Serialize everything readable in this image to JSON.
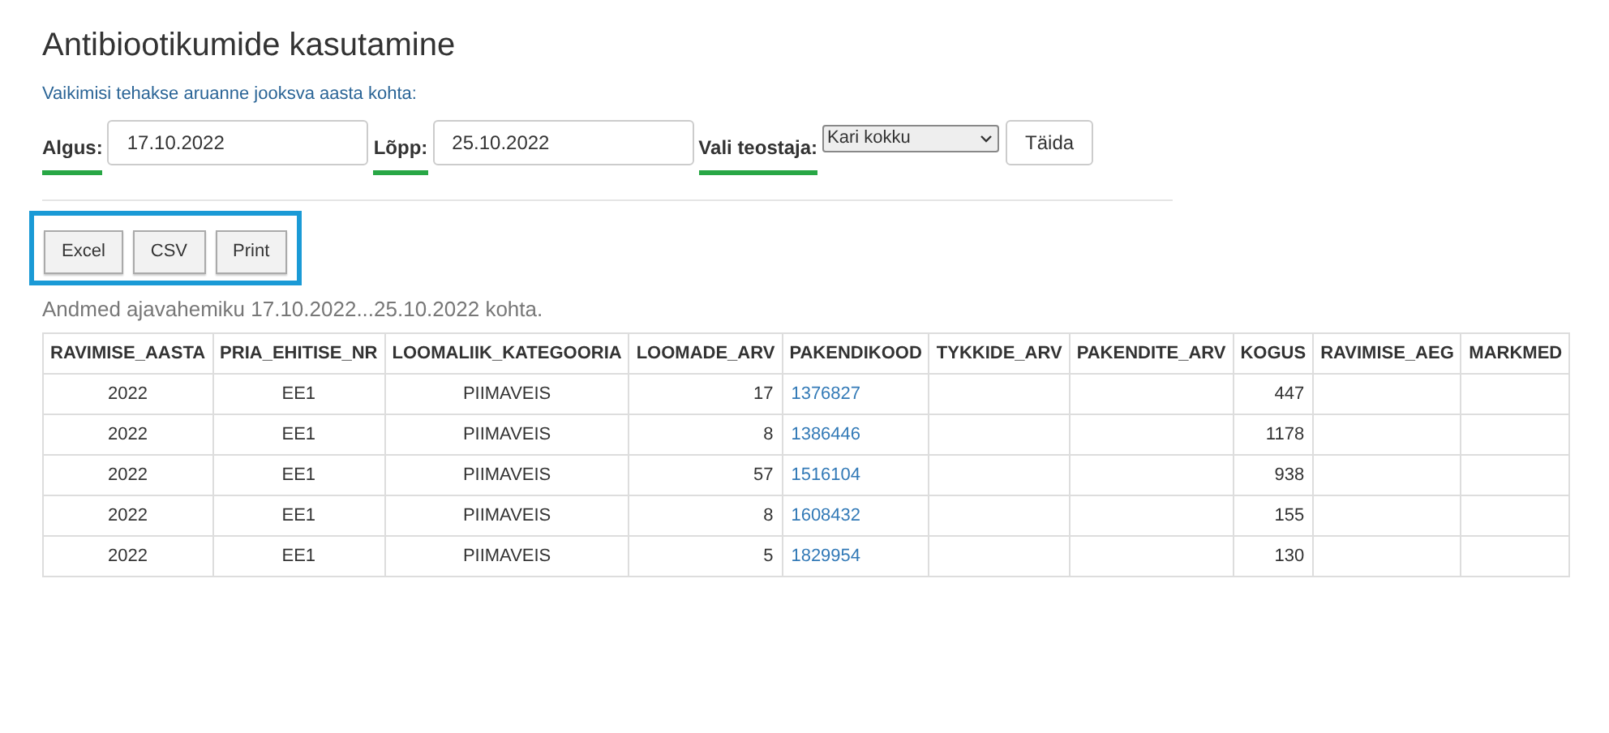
{
  "title": "Antibiootikumide kasutamine",
  "hint": "Vaikimisi tehakse aruanne jooksva aasta kohta:",
  "filters": {
    "start_label": "Algus:",
    "start_value": "17.10.2022",
    "end_label": "Lõpp:",
    "end_value": "25.10.2022",
    "performer_label": "Vali teostaja:",
    "performer_value": "Kari kokku",
    "submit": "Täida"
  },
  "export_buttons": [
    "Excel",
    "CSV",
    "Print"
  ],
  "summary": "Andmed ajavahemiku 17.10.2022...25.10.2022 kohta.",
  "table": {
    "columns": [
      "RAVIMISE_AASTA",
      "PRIA_EHITISE_NR",
      "LOOMALIIK_KATEGOORIA",
      "LOOMADE_ARV",
      "PAKENDIKOOD",
      "TYKKIDE_ARV",
      "PAKENDITE_ARV",
      "KOGUS",
      "RAVIMISE_AEG",
      "MARKMED"
    ],
    "rows": [
      {
        "ravimise_aasta": "2022",
        "pria_ehitise_nr": "EE1",
        "loomaliik_kategooria": "PIIMAVEIS",
        "loomade_arv": "17",
        "pakendikood": "1376827",
        "kogus": "447"
      },
      {
        "ravimise_aasta": "2022",
        "pria_ehitise_nr": "EE1",
        "loomaliik_kategooria": "PIIMAVEIS",
        "loomade_arv": "8",
        "pakendikood": "1386446",
        "kogus": "1178"
      },
      {
        "ravimise_aasta": "2022",
        "pria_ehitise_nr": "EE1",
        "loomaliik_kategooria": "PIIMAVEIS",
        "loomade_arv": "57",
        "pakendikood": "1516104",
        "kogus": "938"
      },
      {
        "ravimise_aasta": "2022",
        "pria_ehitise_nr": "EE1",
        "loomaliik_kategooria": "PIIMAVEIS",
        "loomade_arv": "8",
        "pakendikood": "1608432",
        "kogus": "155"
      },
      {
        "ravimise_aasta": "2022",
        "pria_ehitise_nr": "EE1",
        "loomaliik_kategooria": "PIIMAVEIS",
        "loomade_arv": "5",
        "pakendikood": "1829954",
        "kogus": "130"
      }
    ]
  }
}
